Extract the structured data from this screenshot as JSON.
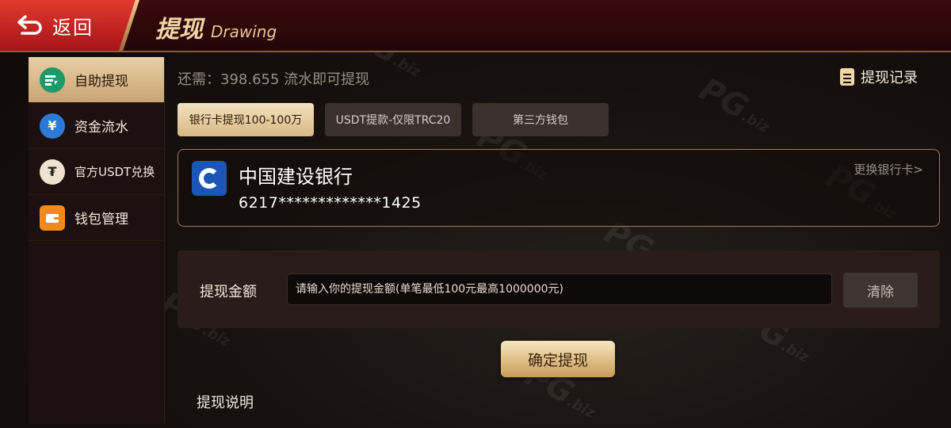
{
  "header": {
    "back_label": "返回",
    "title_zh": "提现",
    "title_en": "Drawing"
  },
  "sidebar": {
    "items": [
      {
        "label": "自助提现",
        "icon": "withdraw-card-icon",
        "active": true
      },
      {
        "label": "资金流水",
        "icon": "yuan-icon",
        "active": false
      },
      {
        "label": "官方USDT兑换",
        "icon": "tether-icon",
        "active": false
      },
      {
        "label": "钱包管理",
        "icon": "wallet-icon",
        "active": false
      }
    ]
  },
  "main": {
    "need_text": "还需：398.655 流水即可提现",
    "record_label": "提现记录",
    "tabs": [
      {
        "label": "银行卡提现100-100万",
        "active": true
      },
      {
        "label": "USDT提款-仅限TRC20",
        "active": false
      },
      {
        "label": "第三方钱包",
        "active": false
      }
    ],
    "bank": {
      "name": "中国建设银行",
      "number": "6217*************1425",
      "change_label": "更换银行卡>"
    },
    "amount": {
      "label": "提现金额",
      "placeholder": "请输入你的提现金额(单笔最低100元最高1000000元)",
      "value": "",
      "clear_label": "清除"
    },
    "confirm_label": "确定提现",
    "notes_title": "提现说明"
  },
  "watermark_text": "PG",
  "watermark_sub": ".biz",
  "colors": {
    "accent_gold": "#d8b884",
    "header_red": "#e03a2c",
    "bank_blue": "#1a55b8"
  }
}
